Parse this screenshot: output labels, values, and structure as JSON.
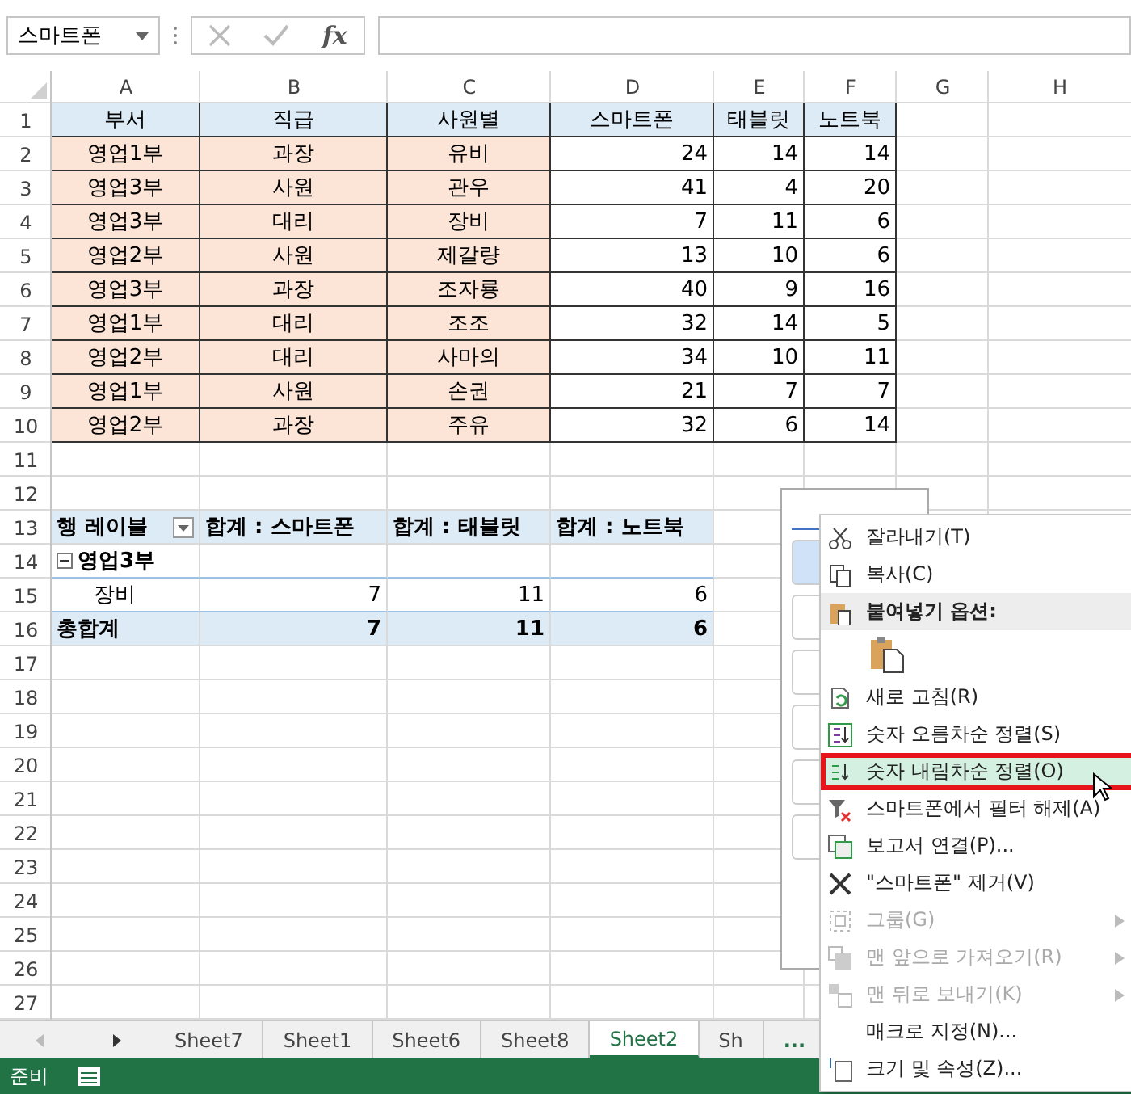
{
  "name_box": {
    "value": "스마트폰"
  },
  "formula_bar": {
    "function_label": "fx"
  },
  "columns": [
    "A",
    "B",
    "C",
    "D",
    "E",
    "F",
    "G",
    "H"
  ],
  "row_headers": [
    "1",
    "2",
    "3",
    "4",
    "5",
    "6",
    "7",
    "8",
    "9",
    "10",
    "11",
    "12",
    "13",
    "14",
    "15",
    "16",
    "17",
    "18",
    "19",
    "20",
    "21",
    "22",
    "23",
    "24",
    "25",
    "26",
    "27"
  ],
  "table": {
    "header": [
      "부서",
      "직급",
      "사원별",
      "스마트폰",
      "태블릿",
      "노트북"
    ],
    "rows": [
      [
        "영업1부",
        "과장",
        "유비",
        "24",
        "14",
        "14"
      ],
      [
        "영업3부",
        "사원",
        "관우",
        "41",
        "4",
        "20"
      ],
      [
        "영업3부",
        "대리",
        "장비",
        "7",
        "11",
        "6"
      ],
      [
        "영업2부",
        "사원",
        "제갈량",
        "13",
        "10",
        "6"
      ],
      [
        "영업3부",
        "과장",
        "조자룡",
        "40",
        "9",
        "16"
      ],
      [
        "영업1부",
        "대리",
        "조조",
        "32",
        "14",
        "5"
      ],
      [
        "영업2부",
        "대리",
        "사마의",
        "34",
        "10",
        "11"
      ],
      [
        "영업1부",
        "사원",
        "손권",
        "21",
        "7",
        "7"
      ],
      [
        "영업2부",
        "과장",
        "주유",
        "32",
        "6",
        "14"
      ]
    ]
  },
  "pivot": {
    "row_label": "행 레이블",
    "value_headers": [
      "합계 : 스마트폰",
      "합계 : 태블릿",
      "합계 : 노트북"
    ],
    "groups": [
      {
        "label": "영업3부",
        "expanded": true,
        "items": [
          {
            "label": "장비",
            "values": [
              "7",
              "11",
              "6"
            ]
          }
        ]
      }
    ],
    "total": {
      "label": "총합계",
      "values": [
        "7",
        "11",
        "6"
      ]
    }
  },
  "context_menu": {
    "items": [
      {
        "kind": "item",
        "label": "잘라내기(T)",
        "disabled": false,
        "selected": false,
        "annotated": false,
        "submenu": false
      },
      {
        "kind": "item",
        "label": "복사(C)",
        "disabled": false,
        "selected": false,
        "annotated": false,
        "submenu": false
      },
      {
        "kind": "header",
        "label": "붙여넣기 옵션:"
      },
      {
        "kind": "paste_options"
      },
      {
        "kind": "item",
        "label": "새로 고침(R)",
        "disabled": false,
        "selected": false,
        "annotated": false,
        "submenu": false
      },
      {
        "kind": "item",
        "label": "숫자 오름차순 정렬(S)",
        "disabled": false,
        "selected": false,
        "annotated": false,
        "submenu": false
      },
      {
        "kind": "item",
        "label": "숫자 내림차순 정렬(O)",
        "disabled": false,
        "selected": true,
        "annotated": true,
        "submenu": false
      },
      {
        "kind": "item",
        "label": "스마트폰에서 필터 해제(A)",
        "disabled": false,
        "selected": false,
        "annotated": false,
        "submenu": false
      },
      {
        "kind": "item",
        "label": "보고서 연결(P)...",
        "disabled": false,
        "selected": false,
        "annotated": false,
        "submenu": false
      },
      {
        "kind": "item",
        "label": "\"스마트폰\" 제거(V)",
        "disabled": false,
        "selected": false,
        "annotated": false,
        "submenu": false
      },
      {
        "kind": "item",
        "label": "그룹(G)",
        "disabled": true,
        "selected": false,
        "annotated": false,
        "submenu": true
      },
      {
        "kind": "item",
        "label": "맨 앞으로 가져오기(R)",
        "disabled": true,
        "selected": false,
        "annotated": false,
        "submenu": true
      },
      {
        "kind": "item",
        "label": "맨 뒤로 보내기(K)",
        "disabled": true,
        "selected": false,
        "annotated": false,
        "submenu": true
      },
      {
        "kind": "item",
        "label": "매크로 지정(N)...",
        "disabled": false,
        "selected": false,
        "annotated": false,
        "submenu": false
      },
      {
        "kind": "item",
        "label": "크기 및 속성(Z)...",
        "disabled": false,
        "selected": false,
        "annotated": false,
        "submenu": false
      }
    ]
  },
  "sheet_tabs": [
    {
      "label": "Sheet7",
      "selected": false
    },
    {
      "label": "Sheet1",
      "selected": false
    },
    {
      "label": "Sheet6",
      "selected": false
    },
    {
      "label": "Sheet8",
      "selected": false
    },
    {
      "label": "Sheet2",
      "selected": true
    },
    {
      "label": "Sh",
      "selected": false
    }
  ],
  "more_tabs": "...",
  "status_bar": {
    "text": "준비"
  }
}
